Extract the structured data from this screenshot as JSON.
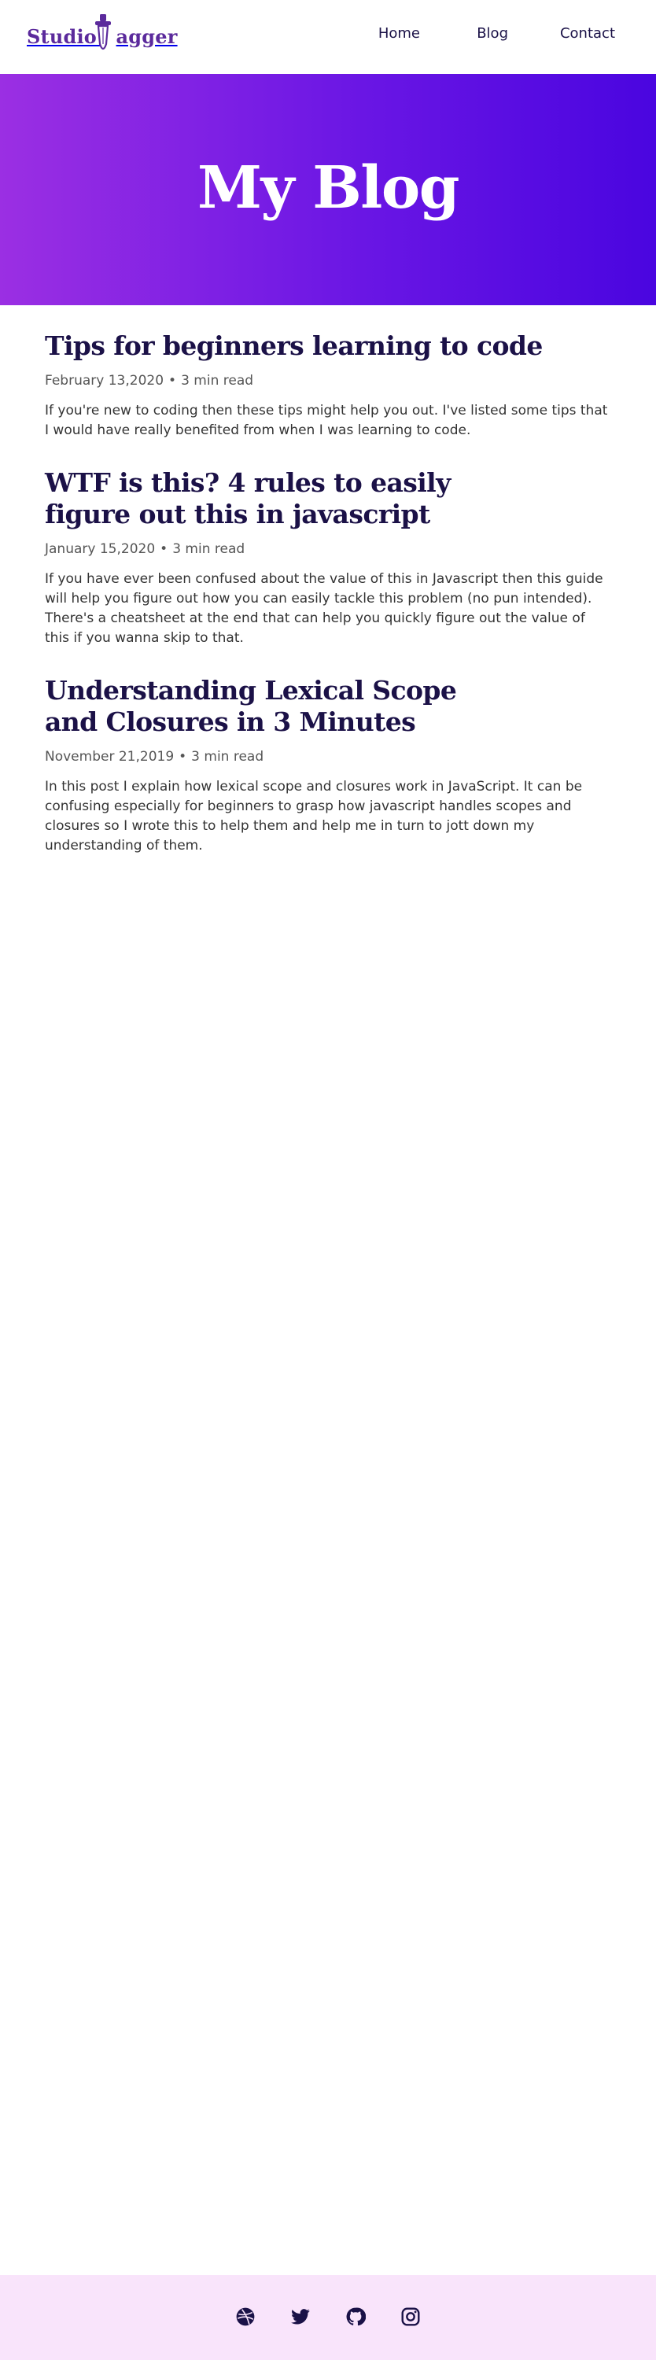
{
  "header": {
    "logo_text": "Studio Dagger",
    "logo_text_part1": "Studio",
    "logo_text_part2": "agger",
    "brand_color": "#5b2a9c",
    "nav": {
      "home": "Home",
      "blog": "Blog",
      "contact": "Contact"
    }
  },
  "hero": {
    "title": "My Blog",
    "gradient_start": "#9b2fe3",
    "gradient_end": "#4a05e0"
  },
  "posts": [
    {
      "title": "Tips for beginners learning to code",
      "date": "February 13,2020",
      "read_time": "3 min read",
      "excerpt": "If you're new to coding then these tips might help you out. I've listed some tips that I would have really benefited from when I was learning to code."
    },
    {
      "title": "WTF is this? 4 rules to easily figure out this in javascript",
      "date": "January 15,2020",
      "read_time": "3 min read",
      "excerpt": "If you have ever been confused about the value of this in Javascript then this guide will help you figure out how you can easily tackle this problem (no pun intended). There's a cheatsheet at the end that can help you quickly figure out the value of this if you wanna skip to that."
    },
    {
      "title": "Understanding Lexical Scope and Closures in 3 Minutes",
      "date": "November 21,2019",
      "read_time": "3 min read",
      "excerpt": "In this post I explain how lexical scope and closures work in JavaScript. It can be confusing especially for beginners to grasp how javascript handles scopes and closures so I wrote this to help them and help me in turn to jott down my understanding of them."
    }
  ],
  "meta_separator": "•",
  "footer": {
    "background": "#f9e4fb",
    "icons": [
      "dribbble-icon",
      "twitter-icon",
      "github-icon",
      "instagram-icon"
    ]
  }
}
